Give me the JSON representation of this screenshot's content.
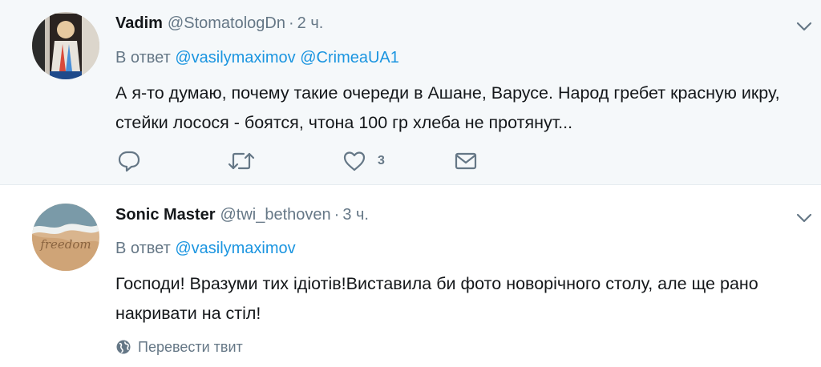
{
  "tweets": [
    {
      "author_name": "Vadim",
      "handle": "@StomatologDn",
      "separator": "·",
      "time": "2 ч.",
      "reply_prefix": "В ответ",
      "mentions": [
        "@vasilymaximov",
        "@CrimeaUA1"
      ],
      "text": "А я-то думаю, почему такие очереди в Ашане, Варусе. Народ гребет красную икру, стейки лосося - боятся, чтона 100 гр хлеба не протянут...",
      "like_count": "3",
      "background": "#f5f8fa"
    },
    {
      "author_name": "Sonic Master",
      "handle": "@twi_bethoven",
      "separator": "·",
      "time": "3 ч.",
      "reply_prefix": "В ответ",
      "mentions": [
        "@vasilymaximov"
      ],
      "text": "Господи! Вразуми тих ідіотів!Виставила би фото новорічного столу, але ще рано накривати на стіл!",
      "translate_label": "Перевести твит",
      "avatar_text": "freedom",
      "background": "#ffffff"
    }
  ],
  "colors": {
    "link": "#1b95e0",
    "secondary": "#657786",
    "primary_text": "#14171a"
  },
  "icons": {
    "more": "chevron-down-icon",
    "reply": "reply-icon",
    "retweet": "retweet-icon",
    "like": "heart-icon",
    "dm": "envelope-icon",
    "translate": "globe-icon"
  }
}
